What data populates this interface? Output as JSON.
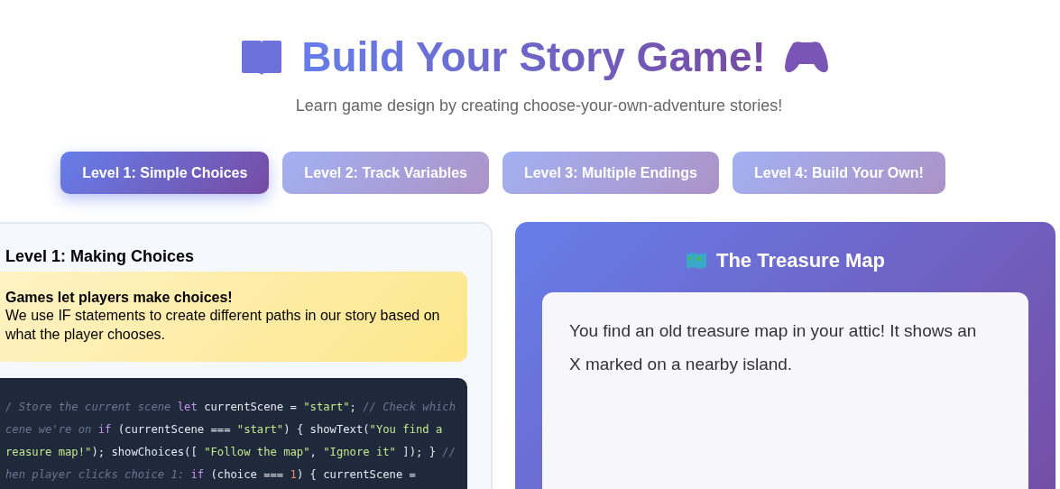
{
  "header": {
    "title": "Build Your Story Game!",
    "subtitle": "Learn game design by creating choose-your-own-adventure stories!"
  },
  "tabs": [
    {
      "label": "Level 1: Simple Choices",
      "selected": true
    },
    {
      "label": "Level 2: Track Variables",
      "selected": false
    },
    {
      "label": "Level 3: Multiple Endings",
      "selected": false
    },
    {
      "label": "Level 4: Build Your Own!",
      "selected": false
    }
  ],
  "lesson": {
    "title": "Level 1: Making Choices",
    "tip": {
      "heading": "Games let players make choices!",
      "text": "We use IF statements to create different paths in our story based on what the player chooses."
    },
    "code_lines": [
      [
        {
          "kind": "comment",
          "text": "/ Store the current scene "
        },
        {
          "kind": "keyword",
          "text": "let"
        },
        {
          "kind": "plain",
          "text": " currentScene = "
        },
        {
          "kind": "string",
          "text": "\"start\""
        },
        {
          "kind": "plain",
          "text": "; "
        },
        {
          "kind": "comment",
          "text": "// Check which"
        }
      ],
      [
        {
          "kind": "comment",
          "text": "cene we're on "
        },
        {
          "kind": "keyword",
          "text": "if"
        },
        {
          "kind": "plain",
          "text": " (currentScene === "
        },
        {
          "kind": "string",
          "text": "\"start\""
        },
        {
          "kind": "plain",
          "text": ") { showText("
        },
        {
          "kind": "string",
          "text": "\"You find a"
        }
      ],
      [
        {
          "kind": "string",
          "text": "reasure map!\""
        },
        {
          "kind": "plain",
          "text": "); showChoices([ "
        },
        {
          "kind": "string",
          "text": "\"Follow the map\""
        },
        {
          "kind": "plain",
          "text": ", "
        },
        {
          "kind": "string",
          "text": "\"Ignore it\""
        },
        {
          "kind": "plain",
          "text": " ]); } "
        },
        {
          "kind": "comment",
          "text": "//"
        }
      ],
      [
        {
          "kind": "comment",
          "text": "hen player clicks choice 1: "
        },
        {
          "kind": "keyword",
          "text": "if"
        },
        {
          "kind": "plain",
          "text": " (choice === "
        },
        {
          "kind": "number",
          "text": "1"
        },
        {
          "kind": "plain",
          "text": ") { currentScene ="
        }
      ]
    ]
  },
  "story": {
    "title": "The Treasure Map",
    "text": "You find an old treasure map in your attic! It shows an X marked on a nearby island."
  }
}
